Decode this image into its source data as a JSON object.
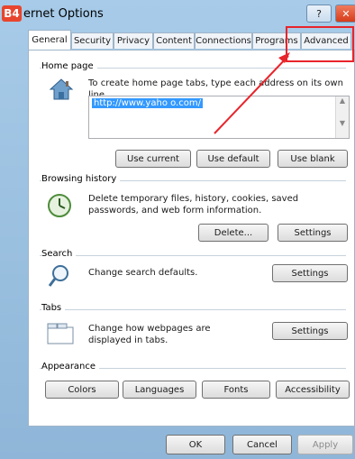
{
  "window": {
    "badge": "B4",
    "title": "ernet Options",
    "help_label": "?",
    "close_label": "✕"
  },
  "tabs": [
    "General",
    "Security",
    "Privacy",
    "Content",
    "Connections",
    "Programs",
    "Advanced"
  ],
  "home_page": {
    "heading": "Home page",
    "description": "To create home page tabs, type each address on its own line.",
    "url": "http://www.yaho o.com/",
    "scroll_up": "▲",
    "scroll_down": "▼",
    "use_current": "Use current",
    "use_default": "Use default",
    "use_blank": "Use blank"
  },
  "browsing_history": {
    "heading": "Browsing history",
    "description": "Delete temporary files, history, cookies, saved passwords, and web form information.",
    "delete": "Delete...",
    "settings": "Settings"
  },
  "search": {
    "heading": "Search",
    "description": "Change search defaults.",
    "settings": "Settings"
  },
  "tabs_section": {
    "heading": "Tabs",
    "description": "Change how webpages are displayed in tabs.",
    "settings": "Settings"
  },
  "appearance": {
    "heading": "Appearance",
    "colors": "Colors",
    "languages": "Languages",
    "fonts": "Fonts",
    "accessibility": "Accessibility"
  },
  "footer": {
    "ok": "OK",
    "cancel": "Cancel",
    "apply": "Apply"
  },
  "colors": {
    "annotation": "#e8242b",
    "selection": "#3399ff"
  }
}
